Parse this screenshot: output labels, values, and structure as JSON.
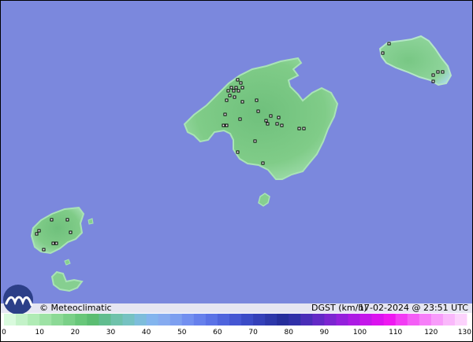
{
  "attribution": "© Meteoclimatic",
  "variable_label": "DGST (km/h)",
  "timestamp": "17-02-2024 @ 23:51 UTC",
  "colors": {
    "sea": "#7b88dd",
    "land_base": "#7ccb85",
    "land_light": "#b4e6c0",
    "land_dark": "#5eb86f",
    "info_bar": "#e6e6f2",
    "frame": "#000000"
  },
  "legend": {
    "ticks": [
      "0",
      "10",
      "20",
      "30",
      "40",
      "50",
      "60",
      "70",
      "80",
      "90",
      "100",
      "110",
      "120",
      "130"
    ],
    "colors": [
      "#d9fadd",
      "#c3f2c8",
      "#b0ebb5",
      "#9ee2a5",
      "#8cd996",
      "#7ad088",
      "#68c77a",
      "#5bbd72",
      "#61bd8f",
      "#6fc2ab",
      "#76c2c2",
      "#7dbddb",
      "#83b5ee",
      "#86abf0",
      "#7d9ff0",
      "#728ff0",
      "#6680ec",
      "#5a72e6",
      "#4f64dd",
      "#4556d3",
      "#3b4bc7",
      "#3440b9",
      "#2d37aa",
      "#262e9c",
      "#3030a8",
      "#4a2db8",
      "#6329c6",
      "#7c25d1",
      "#9420dc",
      "#ac1be4",
      "#c416ea",
      "#db12ef",
      "#ee18f1",
      "#f23cf4",
      "#f45ef6",
      "#f67ef8",
      "#f89cfa",
      "#fab8fb",
      "#fcd2fc"
    ]
  }
}
